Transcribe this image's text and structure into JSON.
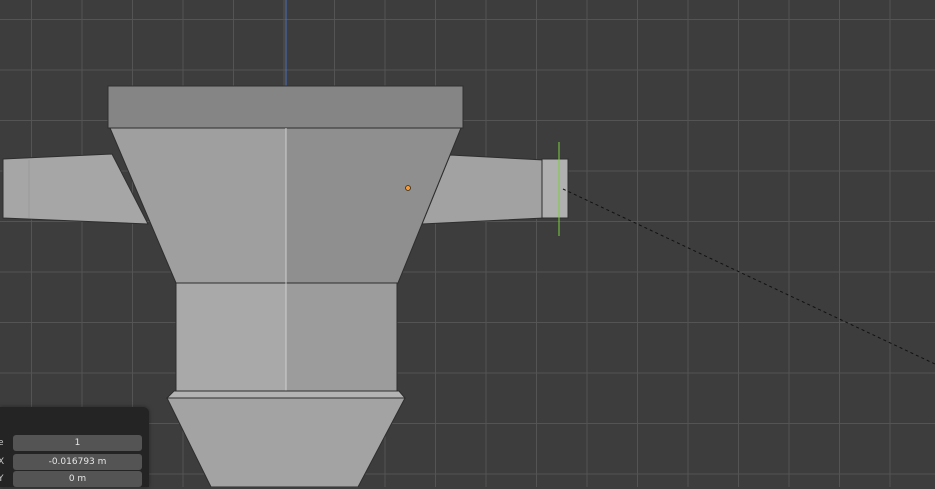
{
  "viewport": {
    "grid_color": "#565656",
    "background_color": "#3d3d3d",
    "axis_z_color": "#4a6fc0",
    "axis_y_color": "#7cd13a",
    "object_origin_color": "#f59a3a"
  },
  "redo_panel": {
    "rows": [
      {
        "label": "e",
        "value": "1"
      },
      {
        "label": "X",
        "value": "-0.016793 m"
      },
      {
        "label": "Y",
        "value": "0 m"
      }
    ]
  }
}
